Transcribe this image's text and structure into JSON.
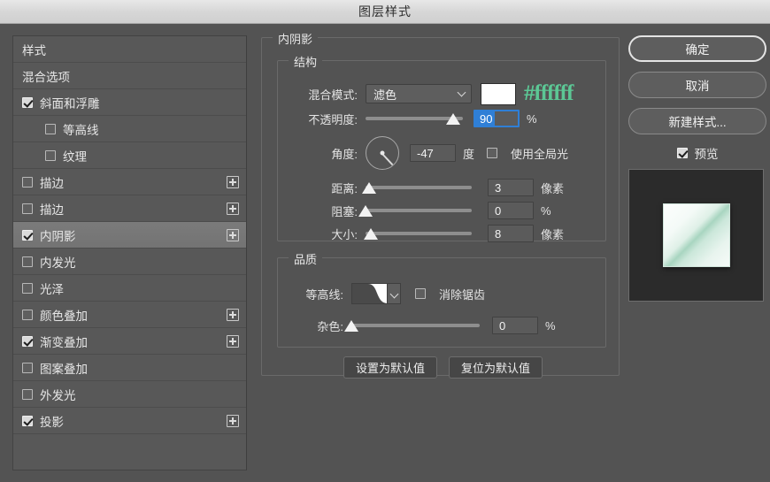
{
  "window": {
    "title": "图层样式"
  },
  "sidebar": {
    "items": [
      {
        "label": "样式",
        "checkbox": "none",
        "plus": false,
        "indent": false,
        "selected": false
      },
      {
        "label": "混合选项",
        "checkbox": "none",
        "plus": false,
        "indent": false,
        "selected": false
      },
      {
        "label": "斜面和浮雕",
        "checkbox": "checked",
        "plus": false,
        "indent": false,
        "selected": false
      },
      {
        "label": "等高线",
        "checkbox": "unchecked",
        "plus": false,
        "indent": true,
        "selected": false
      },
      {
        "label": "纹理",
        "checkbox": "unchecked",
        "plus": false,
        "indent": true,
        "selected": false
      },
      {
        "label": "描边",
        "checkbox": "unchecked",
        "plus": true,
        "indent": false,
        "selected": false
      },
      {
        "label": "描边",
        "checkbox": "unchecked",
        "plus": true,
        "indent": false,
        "selected": false
      },
      {
        "label": "内阴影",
        "checkbox": "checked",
        "plus": true,
        "indent": false,
        "selected": true
      },
      {
        "label": "内发光",
        "checkbox": "unchecked",
        "plus": false,
        "indent": false,
        "selected": false
      },
      {
        "label": "光泽",
        "checkbox": "unchecked",
        "plus": false,
        "indent": false,
        "selected": false
      },
      {
        "label": "颜色叠加",
        "checkbox": "unchecked",
        "plus": true,
        "indent": false,
        "selected": false
      },
      {
        "label": "渐变叠加",
        "checkbox": "checked",
        "plus": true,
        "indent": false,
        "selected": false
      },
      {
        "label": "图案叠加",
        "checkbox": "unchecked",
        "plus": false,
        "indent": false,
        "selected": false
      },
      {
        "label": "外发光",
        "checkbox": "unchecked",
        "plus": false,
        "indent": false,
        "selected": false
      },
      {
        "label": "投影",
        "checkbox": "checked",
        "plus": true,
        "indent": false,
        "selected": false
      }
    ]
  },
  "main": {
    "section_title": "内阴影",
    "structure": {
      "title": "结构",
      "blend_mode": {
        "label": "混合模式:",
        "value": "滤色"
      },
      "color": {
        "swatch_hex": "#ffffff",
        "annotation": "#ffffff",
        "annotation_color": "#5cc795"
      },
      "opacity": {
        "label": "不透明度:",
        "value": "90",
        "unit": "%",
        "slider_pct": 90
      },
      "angle": {
        "label": "角度:",
        "value": "-47",
        "unit": "度",
        "degrees": -47
      },
      "use_global_light": {
        "label": "使用全局光",
        "checked": false
      },
      "distance": {
        "label": "距离:",
        "value": "3",
        "unit": "像素",
        "slider_pct": 3
      },
      "choke": {
        "label": "阻塞:",
        "value": "0",
        "unit": "%",
        "slider_pct": 0
      },
      "size": {
        "label": "大小:",
        "value": "8",
        "unit": "像素",
        "slider_pct": 5
      }
    },
    "quality": {
      "title": "品质",
      "contour": {
        "label": "等高线:"
      },
      "anti_alias": {
        "label": "消除锯齿",
        "checked": false
      },
      "noise": {
        "label": "杂色:",
        "value": "0",
        "unit": "%",
        "slider_pct": 0
      }
    },
    "buttons": {
      "make_default": "设置为默认值",
      "reset_default": "复位为默认值"
    }
  },
  "right": {
    "ok": "确定",
    "cancel": "取消",
    "new_style": "新建样式...",
    "preview": {
      "label": "预览",
      "checked": true
    }
  }
}
